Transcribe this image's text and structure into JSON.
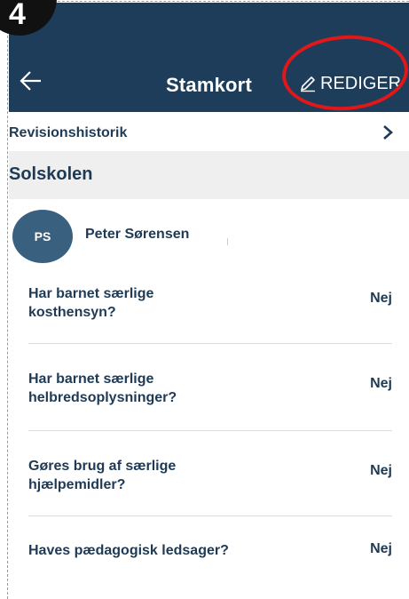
{
  "step_badge": "4",
  "header": {
    "title": "Stamkort",
    "edit_label": "REDIGER"
  },
  "revision": {
    "label": "Revisionshistorik"
  },
  "school": {
    "name": "Solskolen"
  },
  "child": {
    "initials": "PS",
    "name": "Peter Sørensen"
  },
  "questions": [
    {
      "text": "Har barnet særlige kosthensyn?",
      "answer": "Nej"
    },
    {
      "text": "Har barnet særlige helbredsoplysninger?",
      "answer": "Nej"
    },
    {
      "text": "Gøres brug af særlige hjælpemidler?",
      "answer": "Nej"
    },
    {
      "text": "Haves pædagogisk ledsager?",
      "answer": "Nej"
    }
  ],
  "colors": {
    "header": "#1d3d5b",
    "highlight": "#e01818",
    "text": "#1e3a55",
    "avatar": "#3a6080"
  }
}
